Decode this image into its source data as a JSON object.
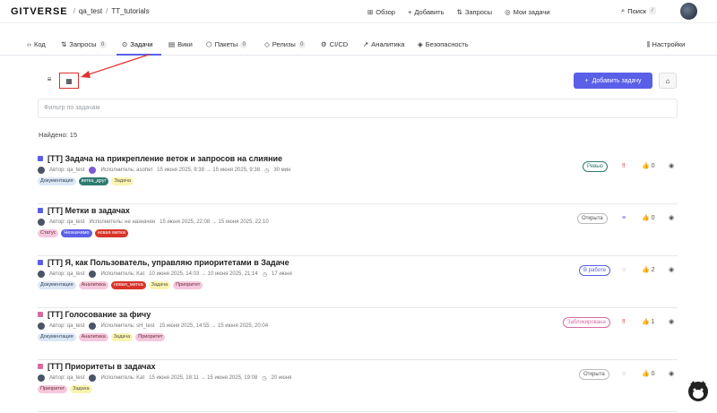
{
  "header": {
    "logo": "GITVERSE",
    "breadcrumb": [
      "qa_test",
      "TT_tutorials"
    ],
    "actions": [
      "Обзор",
      "Добавить",
      "Запросы",
      "Мои задачи"
    ],
    "search": "Поиск",
    "search_key": "/"
  },
  "tabs": [
    {
      "label": "Код",
      "count": ""
    },
    {
      "label": "Запросы",
      "count": "0"
    },
    {
      "label": "Задачи",
      "count": ""
    },
    {
      "label": "Вики",
      "count": ""
    },
    {
      "label": "Пакеты",
      "count": "0"
    },
    {
      "label": "Релизы",
      "count": "0"
    },
    {
      "label": "CI/CD",
      "count": ""
    },
    {
      "label": "Аналитика",
      "count": ""
    },
    {
      "label": "Безопасность",
      "count": ""
    }
  ],
  "settings_label": "Настройки",
  "add_button": "Добавить задачу",
  "filter_placeholder": "Фильтр по задачам",
  "found": "Найдено: 15",
  "issues": [
    {
      "title": "[TT] Задача на прикрепление веток и запросов на слияние",
      "author": "Автор: qa_test",
      "assignee": "Исполнитель: asohet",
      "dates": "15 июня 2025, 9:38 → 15 июня 2025, 9:38",
      "time": "30 мин",
      "labels": [
        "Документация",
        "ветка_друг",
        "Задача"
      ],
      "status": "Ревью",
      "likes": "0"
    },
    {
      "title": "[TT] Метки в задачах",
      "author": "Автор: qa_test",
      "assignee": "Исполнитель: не назначен",
      "dates": "15 июня 2025, 22:08 → 15 июня 2025, 22:10",
      "time": "",
      "labels": [
        "Статус",
        "Незначимо",
        "новая метка"
      ],
      "status": "Открыта",
      "likes": "0"
    },
    {
      "title": "[TT] Я, как Пользователь, управляю приоритетами в Задаче",
      "author": "Автор: qa_test",
      "assignee": "Исполнитель: Kat",
      "dates": "10 июня 2025, 14:03 → 10 июня 2025, 21:14",
      "time": "17 июня",
      "labels": [
        "Документация",
        "Аналитика",
        "новая_метка",
        "Задача",
        "Приоритет"
      ],
      "status": "В работе",
      "likes": "2"
    },
    {
      "title": "[TT] Голосование за фичу",
      "author": "Автор: qa_test",
      "assignee": "Исполнитель: sH_test",
      "dates": "15 июня 2025, 14:55 → 15 июня 2025, 20:04",
      "time": "",
      "labels": [
        "Документация",
        "Аналитика",
        "Задача",
        "Приоритет"
      ],
      "status": "Заблокирована",
      "likes": "1"
    },
    {
      "title": "[TT] Приоритеты в задачах",
      "author": "Автор: qa_test",
      "assignee": "Исполнитель: Kat",
      "dates": "15 июня 2025, 18:11 → 15 июня 2025, 19:08",
      "time": "20 июня",
      "labels": [
        "Приоритет",
        "Задача"
      ],
      "status": "Открыта",
      "likes": "0"
    }
  ]
}
